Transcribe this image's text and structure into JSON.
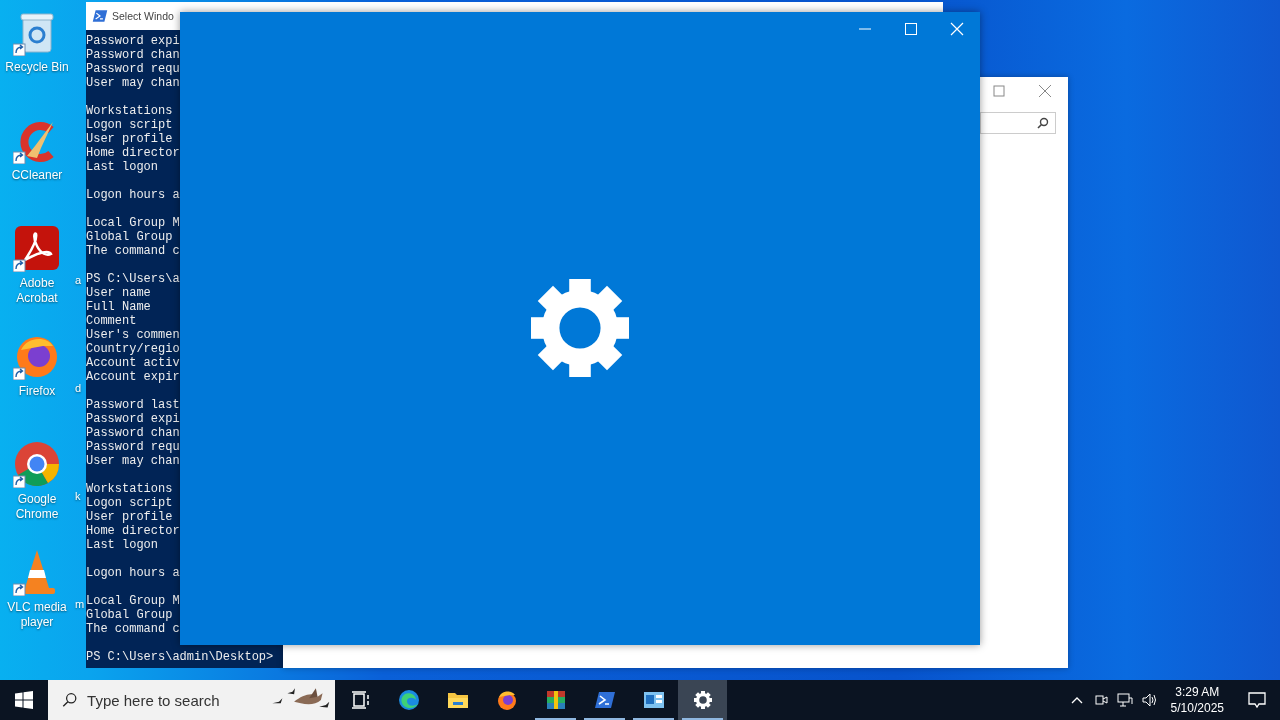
{
  "desktop_icons": [
    {
      "label": "Recycle Bin",
      "kind": "recycle"
    },
    {
      "label": "CCleaner",
      "kind": "ccleaner"
    },
    {
      "label": "Adobe Acrobat",
      "kind": "acrobat"
    },
    {
      "label": "Firefox",
      "kind": "firefox"
    },
    {
      "label": "Google Chrome",
      "kind": "chrome"
    },
    {
      "label": "VLC media player",
      "kind": "vlc"
    }
  ],
  "hidden_icon_labels": [
    "a",
    "d",
    "k",
    "m"
  ],
  "terminal": {
    "title": "Select Windo",
    "blocks": [
      [
        "Password expi",
        "Password chan",
        "Password requ",
        "User may chan"
      ],
      [
        "Workstations",
        "Logon script",
        "User profile",
        "Home director",
        "Last logon"
      ],
      [
        "Logon hours a"
      ],
      [
        "Local Group M",
        "Global Group",
        "The command c"
      ],
      [
        "PS C:\\Users\\a",
        "User name",
        "Full Name",
        "Comment",
        "User's commen",
        "Country/regio",
        "Account activ",
        "Account expir"
      ],
      [
        "Password last",
        "Password expi",
        "Password chan",
        "Password requ",
        "User may chan"
      ],
      [
        "Workstations",
        "Logon script",
        "User profile",
        "Home director",
        "Last logon"
      ],
      [
        "Logon hours a"
      ],
      [
        "Local Group M",
        "Global Group",
        "The command c"
      ],
      [
        "PS C:\\Users\\admin\\Desktop>"
      ]
    ]
  },
  "taskbar": {
    "search": {
      "placeholder": "Type here to search"
    },
    "apps": [
      {
        "kind": "taskview",
        "running": false,
        "selected": false
      },
      {
        "kind": "edge",
        "running": false,
        "selected": false
      },
      {
        "kind": "explorer",
        "running": false,
        "selected": false
      },
      {
        "kind": "firefox",
        "running": false,
        "selected": false
      },
      {
        "kind": "winrar",
        "running": true,
        "selected": false
      },
      {
        "kind": "powershell",
        "running": true,
        "selected": false
      },
      {
        "kind": "panel",
        "running": true,
        "selected": false
      },
      {
        "kind": "settings",
        "running": true,
        "selected": true
      }
    ],
    "time": "3:29 AM",
    "date": "5/10/2025"
  }
}
